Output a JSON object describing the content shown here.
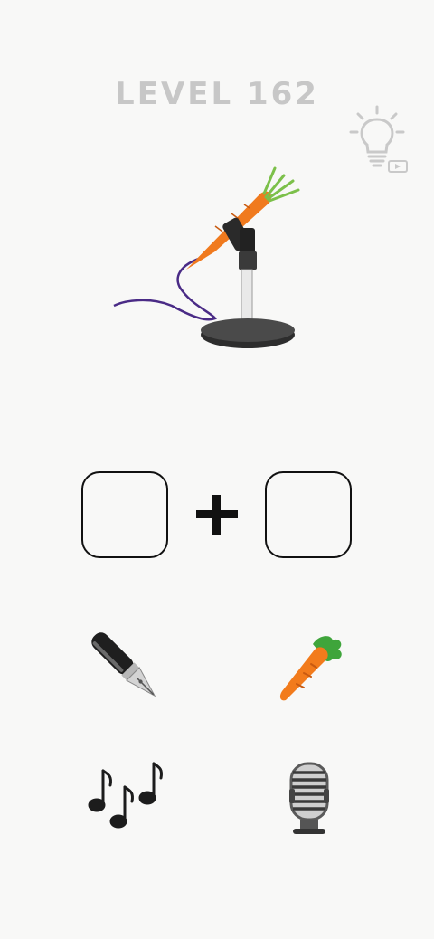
{
  "level": {
    "title": "LEVEL 162"
  },
  "hint": {
    "icon": "lightbulb-icon",
    "badge_icon": "video-play-icon"
  },
  "puzzle": {
    "image_icon": "carrot-microphone-icon"
  },
  "answer": {
    "slots": [
      "",
      ""
    ],
    "operator_icon": "plus-icon"
  },
  "options": [
    {
      "icon": "fountain-pen-icon"
    },
    {
      "icon": "carrot-icon"
    },
    {
      "icon": "musical-notes-icon"
    },
    {
      "icon": "studio-microphone-icon"
    }
  ],
  "colors": {
    "background": "#f8f8f7",
    "title": "#c7c7c7",
    "carrot": "#f07a1e",
    "cable": "#4a2b86"
  }
}
